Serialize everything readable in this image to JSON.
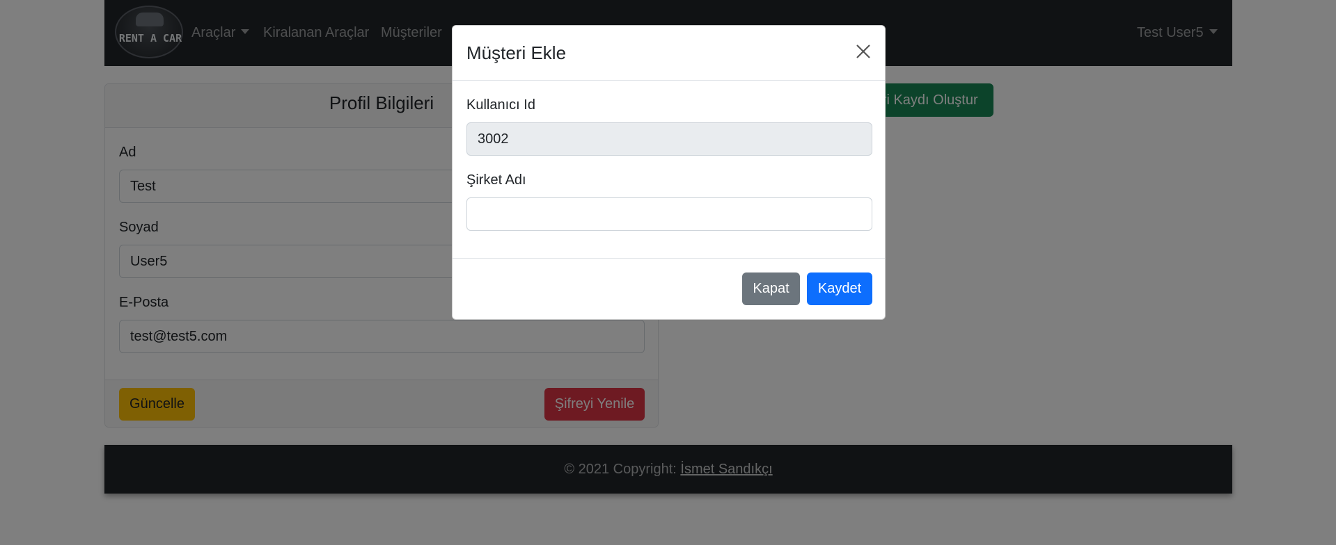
{
  "navbar": {
    "logo_text": "RENT A CAR",
    "items": [
      {
        "label": "Araçlar",
        "dropdown": true
      },
      {
        "label": "Kiralanan Araçlar"
      },
      {
        "label": "Müşteriler"
      }
    ],
    "user_menu_label": "Test User5"
  },
  "profile_card": {
    "title": "Profil Bilgileri",
    "fields": [
      {
        "label": "Ad",
        "value": "Test"
      },
      {
        "label": "Soyad",
        "value": "User5"
      },
      {
        "label": "E-Posta",
        "value": "test@test5.com"
      }
    ],
    "update_button": "Güncelle",
    "reset_password_button": "Şifreyi Yenile"
  },
  "create_customer_button": "Müşteri Kaydı Oluştur",
  "footer": {
    "prefix": "© 2021 Copyright: ",
    "author_link": "İsmet Sandıkçı"
  },
  "modal": {
    "title": "Müşteri Ekle",
    "user_id_label": "Kullanıcı Id",
    "user_id_value": "3002",
    "company_label": "Şirket Adı",
    "company_value": "",
    "close_button": "Kapat",
    "save_button": "Kaydet"
  },
  "colors": {
    "navbar_bg": "#212529",
    "primary": "#0d6efd",
    "secondary": "#6c757d",
    "warning": "#ffc107",
    "danger": "#dc3545",
    "success": "#198754"
  }
}
